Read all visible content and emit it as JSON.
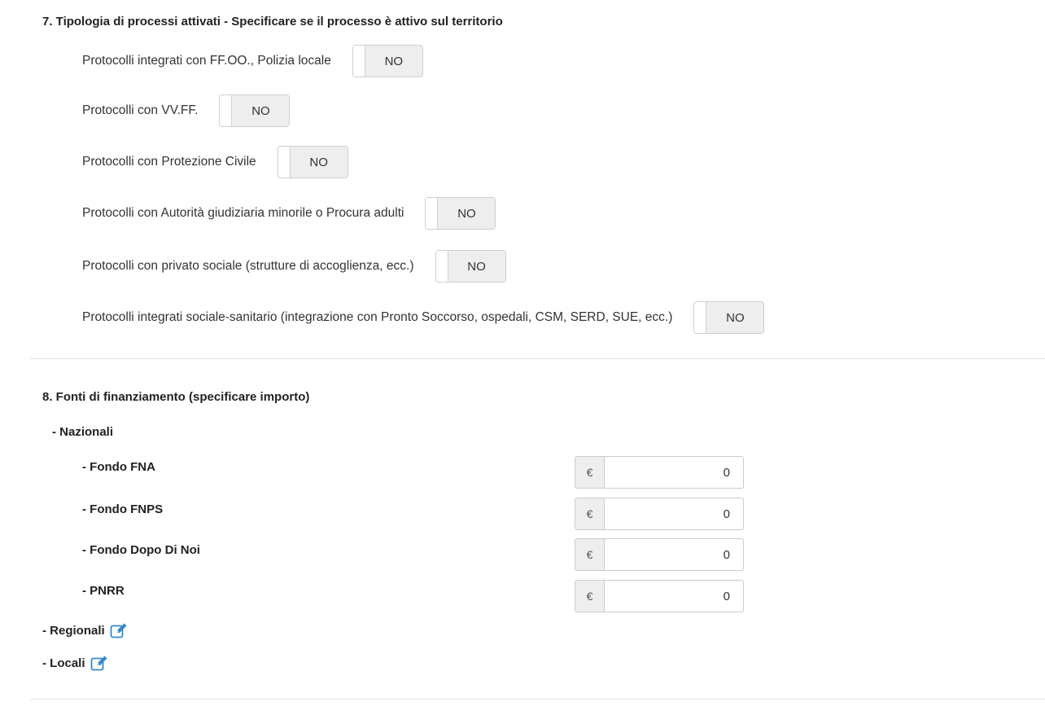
{
  "section7": {
    "title": "7. Tipologia di processi attivati - Specificare se il processo è attivo sul territorio",
    "toggles": [
      {
        "label": "Protocolli integrati con FF.OO., Polizia locale",
        "value": "NO"
      },
      {
        "label": "Protocolli con VV.FF.",
        "value": "NO"
      },
      {
        "label": "Protocolli con Protezione Civile",
        "value": "NO"
      },
      {
        "label": "Protocolli con Autorità giudiziaria minorile o Procura adulti",
        "value": "NO"
      },
      {
        "label": "Protocolli con privato sociale (strutture di accoglienza, ecc.)",
        "value": "NO"
      },
      {
        "label": "Protocolli integrati sociale-sanitario (integrazione con Pronto Soccorso, ospedali, CSM, SERD, SUE, ecc.)",
        "value": "NO"
      }
    ]
  },
  "section8": {
    "title": "8. Fonti di finanziamento (specificare importo)",
    "nazionali_label": "- Nazionali",
    "currency_symbol": "€",
    "funds": [
      {
        "label": "- Fondo FNA",
        "value": "0"
      },
      {
        "label": "- Fondo FNPS",
        "value": "0"
      },
      {
        "label": "- Fondo Dopo Di Noi",
        "value": "0"
      },
      {
        "label": "- PNRR",
        "value": "0"
      }
    ],
    "regionali_label": "- Regionali",
    "locali_label": "- Locali",
    "edit_icon": "edit-icon"
  },
  "colors": {
    "accent": "#3a87c8",
    "toggle_bg": "#eeeeee",
    "divider": "#e3e3e3"
  }
}
